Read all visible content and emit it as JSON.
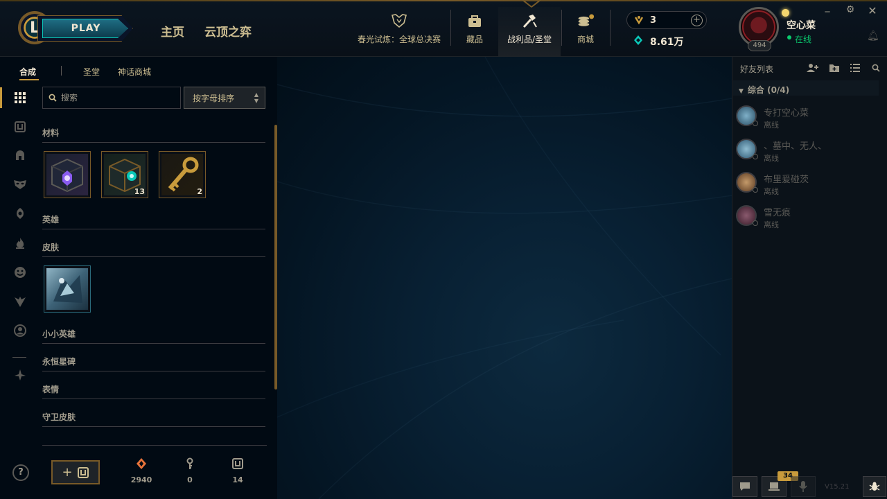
{
  "header": {
    "play_label": "PLAY",
    "nav_home": "主页",
    "nav_tft": "云顶之弈",
    "event_label": "春光试炼：全球总决赛",
    "collection_label": "藏品",
    "loot_label": "战利品/圣堂",
    "store_label": "商城",
    "rp_amount": "3",
    "be_amount": "8.61万",
    "user": {
      "name": "空心菜",
      "status": "在线",
      "level": "494"
    },
    "window_controls": [
      "minimize-icon",
      "settings-icon",
      "close-icon"
    ]
  },
  "loot": {
    "subtabs": [
      "合成",
      "圣堂",
      "神话商城"
    ],
    "active_subtab": "合成",
    "search_placeholder": "搜索",
    "sort_label": "按字母排序",
    "sidebar_icons": [
      "grid-icon",
      "chest-icon",
      "helmet-icon",
      "mask-icon",
      "ward-icon",
      "flame-icon",
      "emote-icon",
      "companion-icon",
      "profile-icon",
      "prestige-icon"
    ],
    "sections": [
      {
        "title": "材料",
        "items": [
          {
            "name": "hextech-chest",
            "count": ""
          },
          {
            "name": "masterwork-chest",
            "count": "13"
          },
          {
            "name": "hextech-key",
            "count": "2"
          }
        ]
      },
      {
        "title": "英雄",
        "items": []
      },
      {
        "title": "皮肤",
        "items": [
          {
            "name": "skin-shard",
            "count": ""
          }
        ]
      },
      {
        "title": "小小英雄",
        "items": []
      },
      {
        "title": "永恒星碑",
        "items": []
      },
      {
        "title": "表情",
        "items": []
      },
      {
        "title": "守卫皮肤",
        "items": []
      }
    ],
    "resources": {
      "essence": "2940",
      "key_fragments": "0",
      "chests": "14"
    },
    "craft_label": "+"
  },
  "friends": {
    "title": "好友列表",
    "group_label": "综合 (0/4)",
    "list": [
      {
        "name": "专打空心菜",
        "status": "离线"
      },
      {
        "name": "、墓中、无人、",
        "status": "离线"
      },
      {
        "name": "布里爰碰茨",
        "status": "离线"
      },
      {
        "name": "雪无痕",
        "status": "离线"
      }
    ],
    "notification_count": "34",
    "version": "V15.21"
  },
  "colors": {
    "gold": "#c89b3c",
    "gold_dark": "#785a28",
    "text_light": "#f0e6d2",
    "text_mid": "#a09b8c",
    "online": "#0acb6e",
    "background": "#010a13"
  }
}
